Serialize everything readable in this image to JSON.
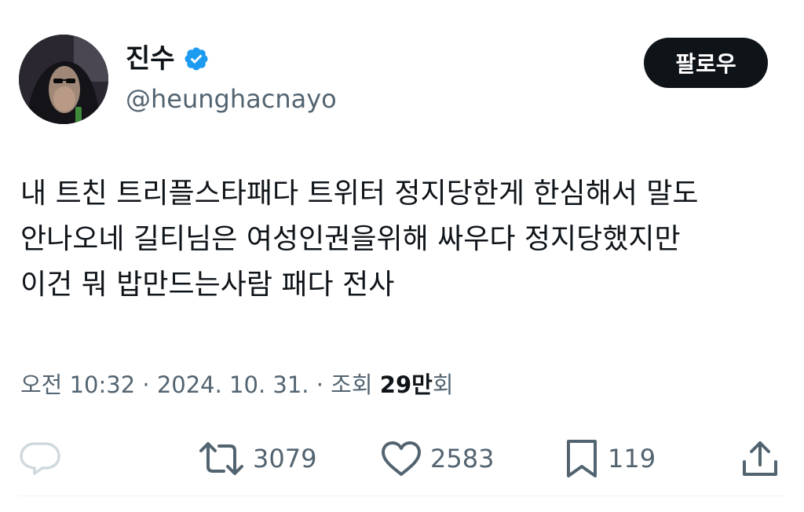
{
  "author": {
    "display_name": "진수",
    "handle": "@heunghacnayo",
    "verified": true
  },
  "follow_button": {
    "label": "팔로우"
  },
  "tweet": {
    "text": "내 트친 트리플스타패다 트위터 정지당한게 한심해서 말도\n안나오네 길티님은 여성인권을위해 싸우다 정지당했지만\n이건 뭐 밥만드는사람 패다 전사"
  },
  "meta": {
    "time": "오전 10:32",
    "separator": "·",
    "date": "2024. 10. 31.",
    "views_label_prefix": "조회",
    "views_count": "29만",
    "views_label_suffix": "회"
  },
  "actions": {
    "reply": {
      "icon": "reply-icon",
      "count": ""
    },
    "retweet": {
      "icon": "retweet-icon",
      "count": "3079"
    },
    "like": {
      "icon": "heart-icon",
      "count": "2583"
    },
    "bookmark": {
      "icon": "bookmark-icon",
      "count": "119"
    },
    "share": {
      "icon": "share-icon"
    }
  },
  "colors": {
    "text_primary": "#0f1419",
    "text_secondary": "#536471",
    "verified_blue": "#1d9bf0",
    "follow_button_bg": "#0f1419",
    "reply_icon": "#cfd9de"
  }
}
